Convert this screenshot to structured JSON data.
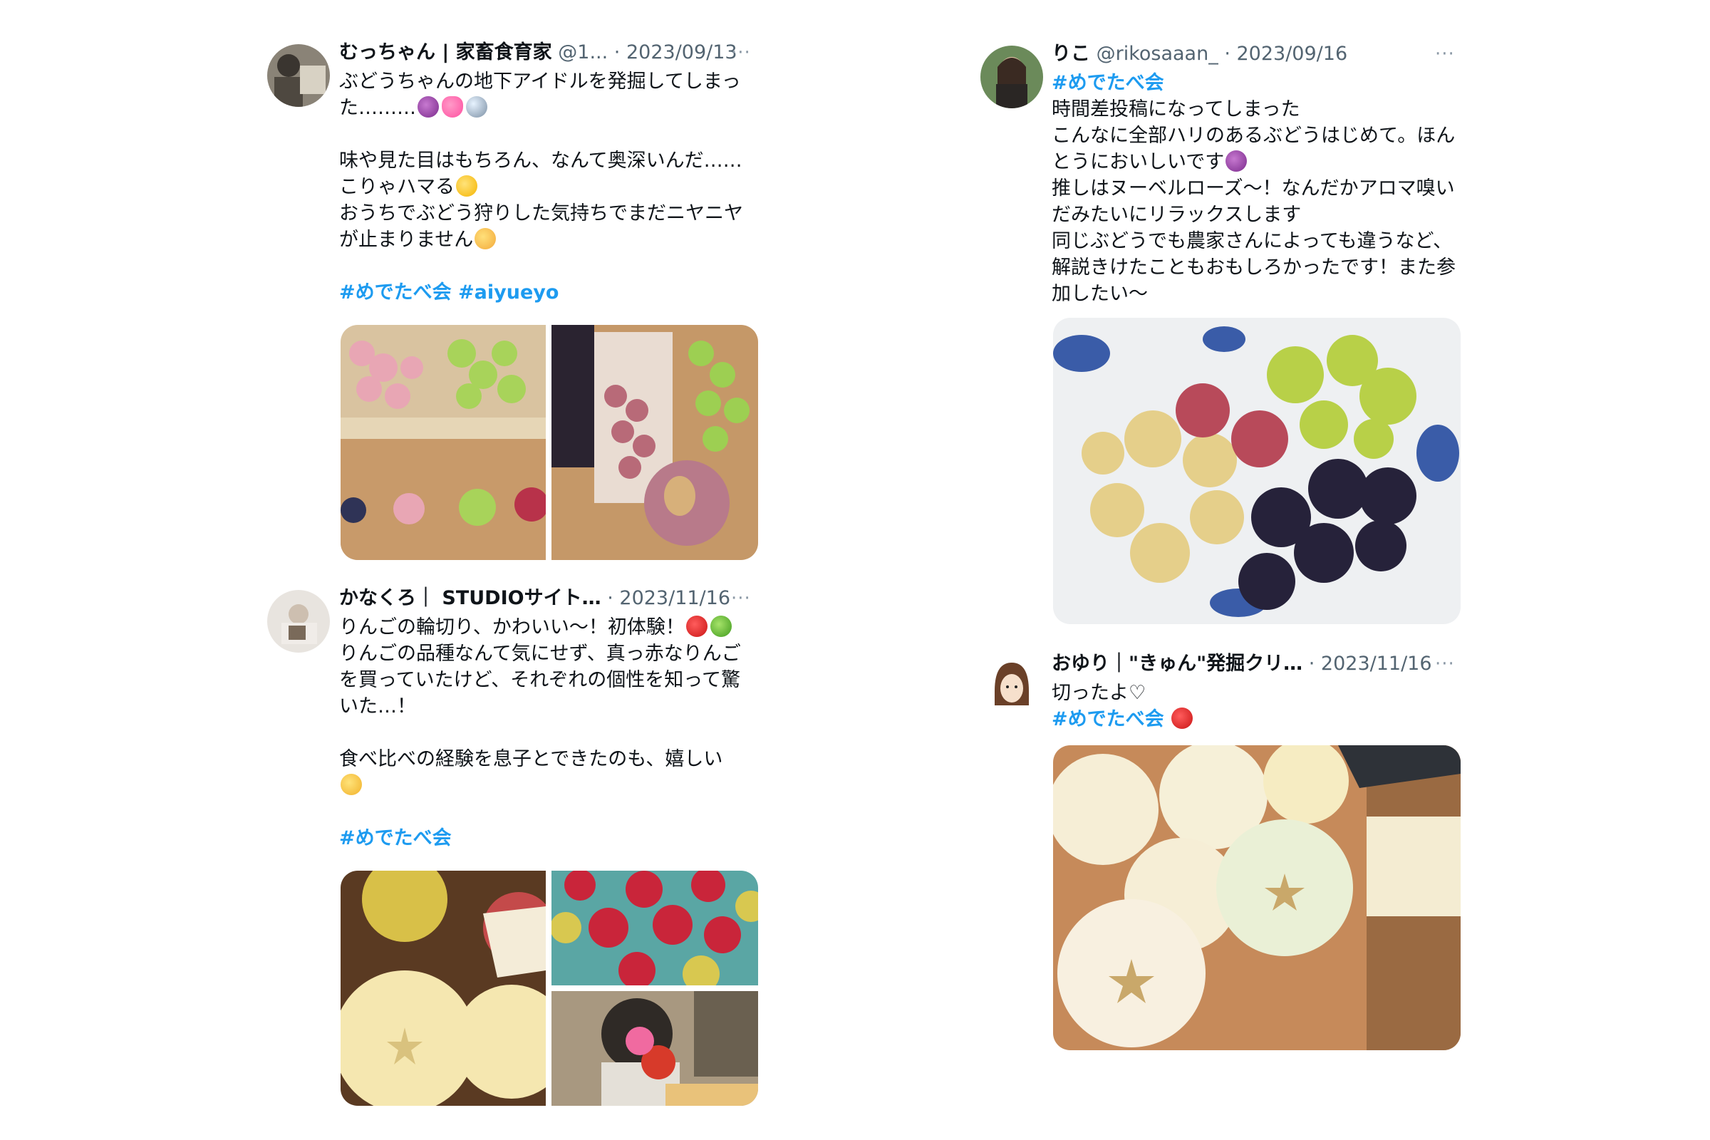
{
  "tweets": [
    {
      "name": "むっちゃん | 家畜食育家",
      "handle": "@1...",
      "date": "2023/09/13",
      "more": "···",
      "lines": [
        "ぶどうちゃんの地下アイドルを発掘してしまっ",
        "た………",
        "",
        "味や見た目はもちろん、なんて奥深いんだ……",
        "こりゃハマる",
        "おうちでぶどう狩りした気持ちでまだニヤニヤ",
        "が止まりません",
        ""
      ],
      "tags": "#めでたべ会 #aiyueyo",
      "emojis": [
        "grape",
        "heart",
        "magnifying-glass",
        "star-struck",
        "shushing-face"
      ]
    },
    {
      "name": "かなくろ｜ STUDIOサイト…",
      "handle": "",
      "date": "2023/11/16",
      "more": "···",
      "lines": [
        "りんごの輪切り、かわいい〜！初体験！",
        "りんごの品種なんて気にせず、真っ赤なりんご",
        "を買っていたけど、それぞれの個性を知って驚",
        "いた…！",
        "",
        "食べ比べの経験を息子とできたのも、嬉しい",
        "",
        ""
      ],
      "tags": "#めでたべ会",
      "emojis": [
        "red-apple",
        "green-apple",
        "smiling-face"
      ]
    },
    {
      "name": "りこ",
      "handle": "@rikosaaan_",
      "date": "2023/09/16",
      "more": "···",
      "tags": "#めでたべ会",
      "lines": [
        "時間差投稿になってしまった",
        "こんなに全部ハリのあるぶどうはじめて。ほん",
        "とうにおいしいです",
        "推しはヌーベルローズ〜！なんだかアロマ嗅い",
        "だみたいにリラックスします",
        "同じぶどうでも農家さんによっても違うなど、",
        "解説きけたこともおもしろかったです！また参",
        "加したい〜"
      ],
      "emojis": [
        "grape"
      ]
    },
    {
      "name": "おゆり｜\"きゅん\"発掘クリ…",
      "handle": "",
      "date": "2023/11/16",
      "more": "···",
      "lines": [
        "切ったよ♡"
      ],
      "tags": "#めでたべ会",
      "emojis": [
        "red-apple"
      ]
    }
  ],
  "colors": {
    "hashtag": "#1d9bf0",
    "meta": "#536471",
    "text": "#0f1419"
  }
}
